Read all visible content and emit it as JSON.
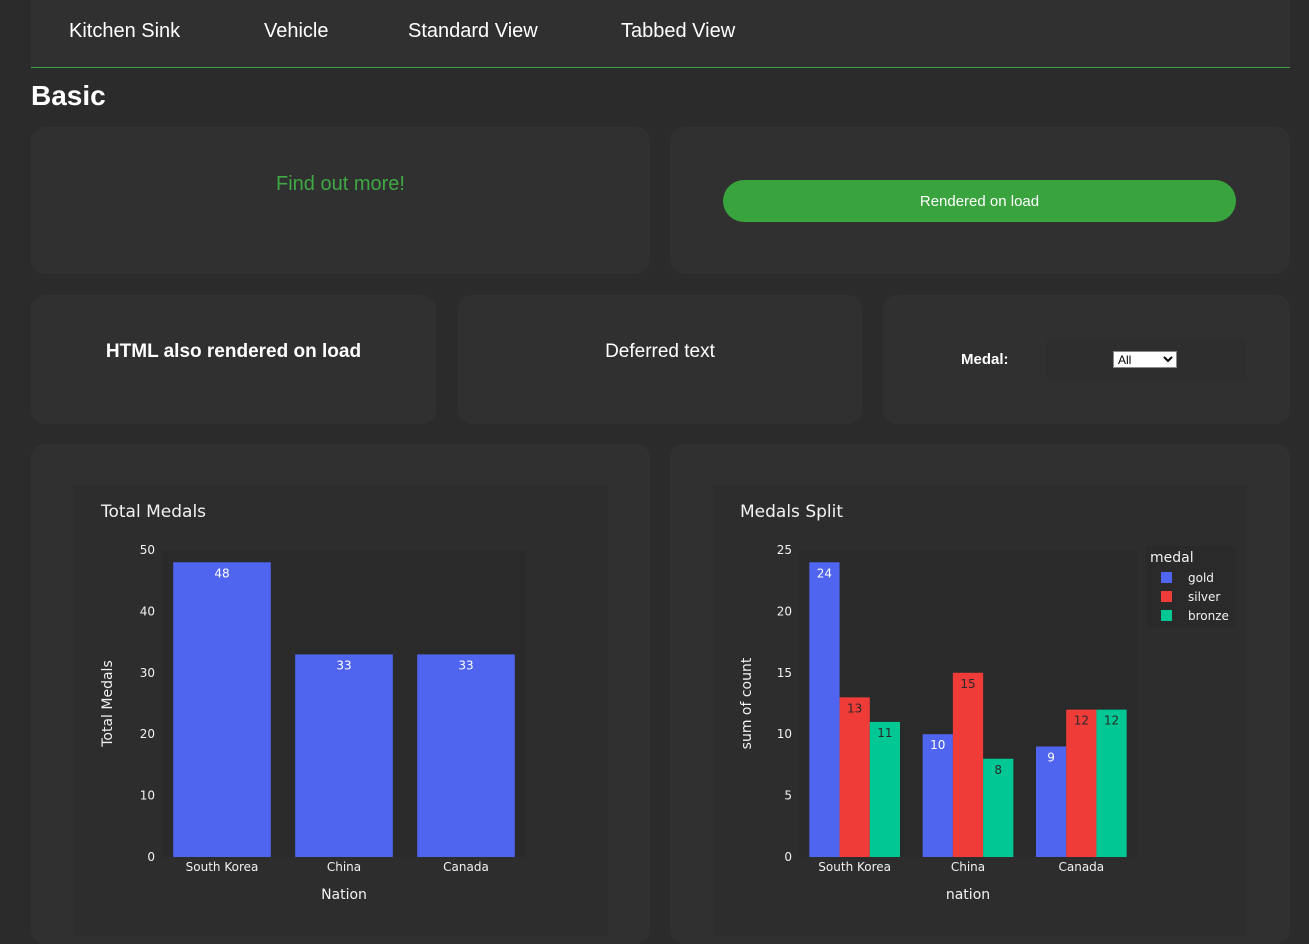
{
  "nav": {
    "tabs": [
      {
        "label": "Kitchen Sink"
      },
      {
        "label": "Vehicle"
      },
      {
        "label": "Standard View"
      },
      {
        "label": "Tabbed View"
      }
    ]
  },
  "page_title": "Basic",
  "cards": {
    "find_out_more": "Find out more!",
    "rendered_button": "Rendered on load",
    "html_rendered": "HTML also rendered on load",
    "deferred_text": "Deferred text",
    "medal_label": "Medal:",
    "medal_select": {
      "selected": "All"
    }
  },
  "colors": {
    "accent_green": "#39a33e",
    "gold": "#4f65f0",
    "silver": "#ef3c38",
    "bronze": "#00c793"
  },
  "chart_data": [
    {
      "type": "bar",
      "title": "Total Medals",
      "xlabel": "Nation",
      "ylabel": "Total Medals",
      "categories": [
        "South Korea",
        "China",
        "Canada"
      ],
      "values": [
        48,
        33,
        33
      ],
      "value_labels": [
        "48",
        "33",
        "33"
      ],
      "ylim": [
        0,
        50
      ],
      "yticks": [
        0,
        10,
        20,
        30,
        40,
        50
      ],
      "grid": false
    },
    {
      "type": "bar",
      "title": "Medals Split",
      "xlabel": "nation",
      "ylabel": "sum of count",
      "categories": [
        "South Korea",
        "China",
        "Canada"
      ],
      "legend_title": "medal",
      "legend_position": "top-right",
      "series": [
        {
          "name": "gold",
          "values": [
            24,
            10,
            9
          ]
        },
        {
          "name": "silver",
          "values": [
            13,
            15,
            12
          ]
        },
        {
          "name": "bronze",
          "values": [
            11,
            8,
            12
          ]
        }
      ],
      "ylim": [
        0,
        25
      ],
      "yticks": [
        0,
        5,
        10,
        15,
        20,
        25
      ],
      "grid": false
    }
  ]
}
